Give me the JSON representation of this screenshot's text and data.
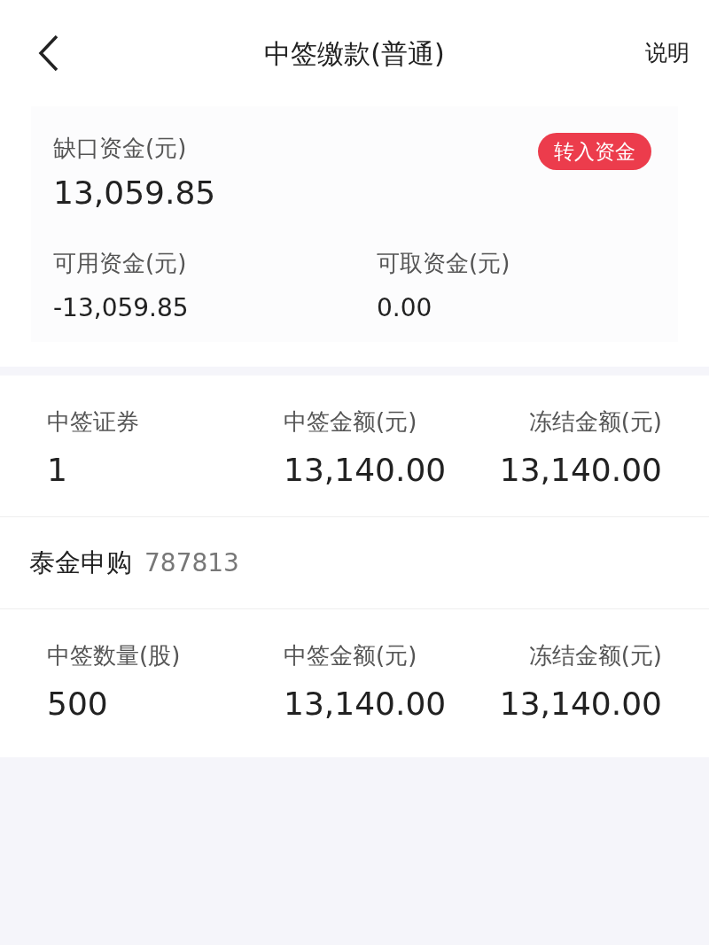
{
  "header": {
    "title": "中签缴款(普通)",
    "help": "说明"
  },
  "funds": {
    "shortfall": {
      "label": "缺口资金(元)",
      "value": "13,059.85"
    },
    "transfer_button": "转入资金",
    "balances": [
      {
        "label": "可用资金(元)",
        "value": "-13,059.85"
      },
      {
        "label": "可取资金(元)",
        "value": "0.00"
      }
    ]
  },
  "summary": [
    {
      "label": "中签证券",
      "value": "1"
    },
    {
      "label": "中签金额(元)",
      "value": "13,140.00"
    },
    {
      "label": "冻结金额(元)",
      "value": "13,140.00"
    }
  ],
  "stocks": [
    {
      "name": "泰金申购",
      "code": "787813",
      "fields": [
        {
          "label": "中签数量(股)",
          "value": "500"
        },
        {
          "label": "中签金额(元)",
          "value": "13,140.00"
        },
        {
          "label": "冻结金额(元)",
          "value": "13,140.00"
        }
      ]
    }
  ]
}
